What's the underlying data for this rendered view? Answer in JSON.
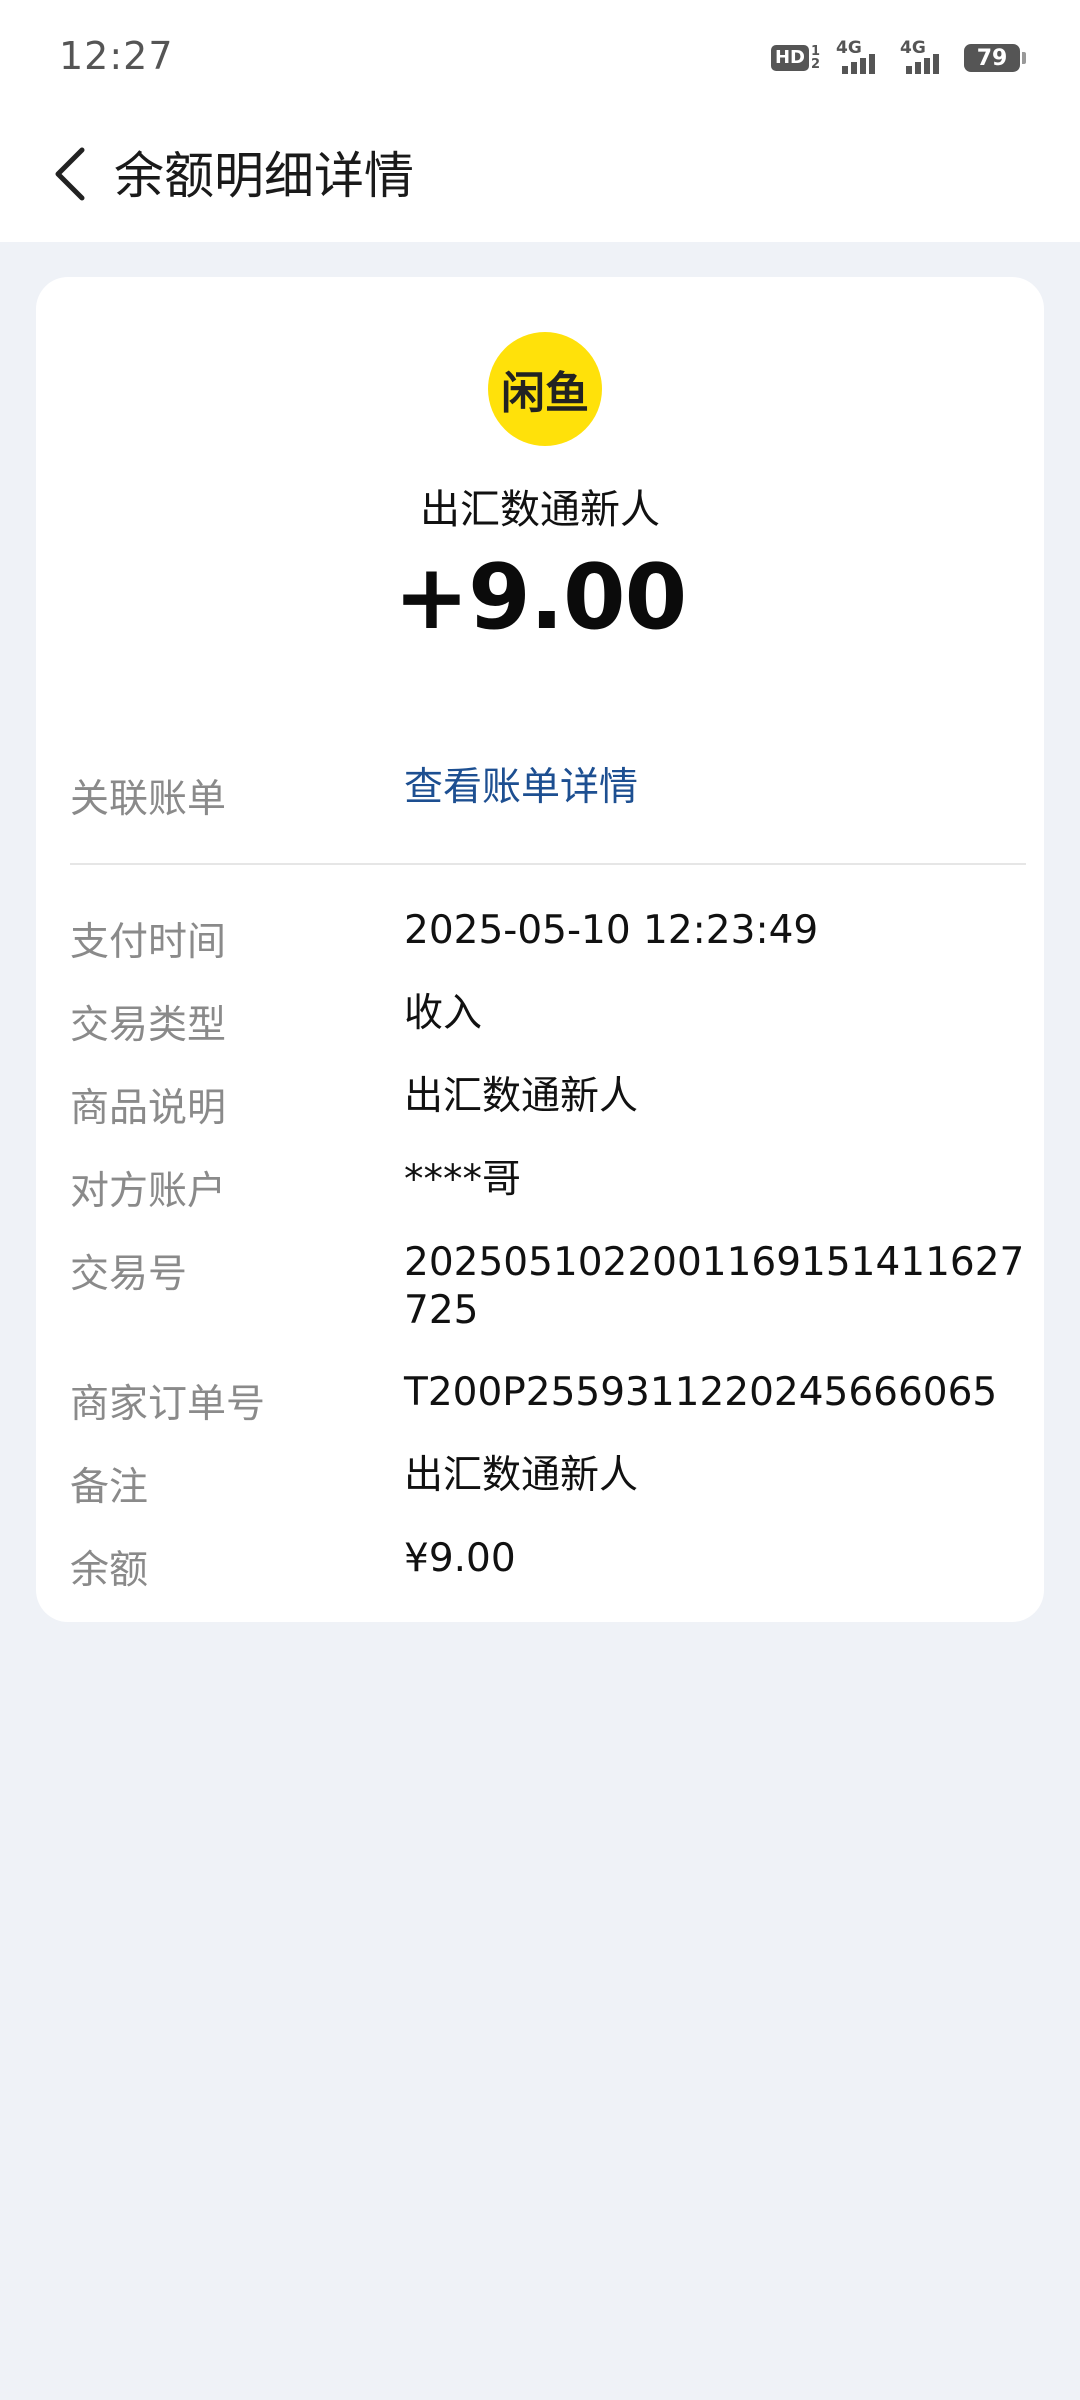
{
  "status": {
    "time": "12:27",
    "hd_label": "HD",
    "hd_sub1": "1",
    "hd_sub2": "2",
    "signal1_label": "4G",
    "signal2_label": "4G",
    "battery": "79"
  },
  "nav": {
    "back_icon": "chevron-left-icon",
    "title": "余额明细详情"
  },
  "merchant": {
    "logo_text": "闲鱼",
    "logo_color": "#ffe10a",
    "name": "出汇数通新人",
    "amount": "+9.00"
  },
  "linked_bill": {
    "label": "关联账单",
    "link_text": "查看账单详情",
    "link_color": "#1d4f91"
  },
  "details": [
    {
      "label": "支付时间",
      "value": "2025-05-10 12:23:49"
    },
    {
      "label": "交易类型",
      "value": "收入"
    },
    {
      "label": "商品说明",
      "value": "出汇数通新人"
    },
    {
      "label": "对方账户",
      "value": "****哥"
    },
    {
      "label": "交易号",
      "value": "2025051022001169151411627725"
    },
    {
      "label": "商家订单号",
      "value": "T200P2559311220245666065"
    },
    {
      "label": "备注",
      "value": "出汇数通新人"
    },
    {
      "label": "余额",
      "value": "¥9.00"
    }
  ]
}
